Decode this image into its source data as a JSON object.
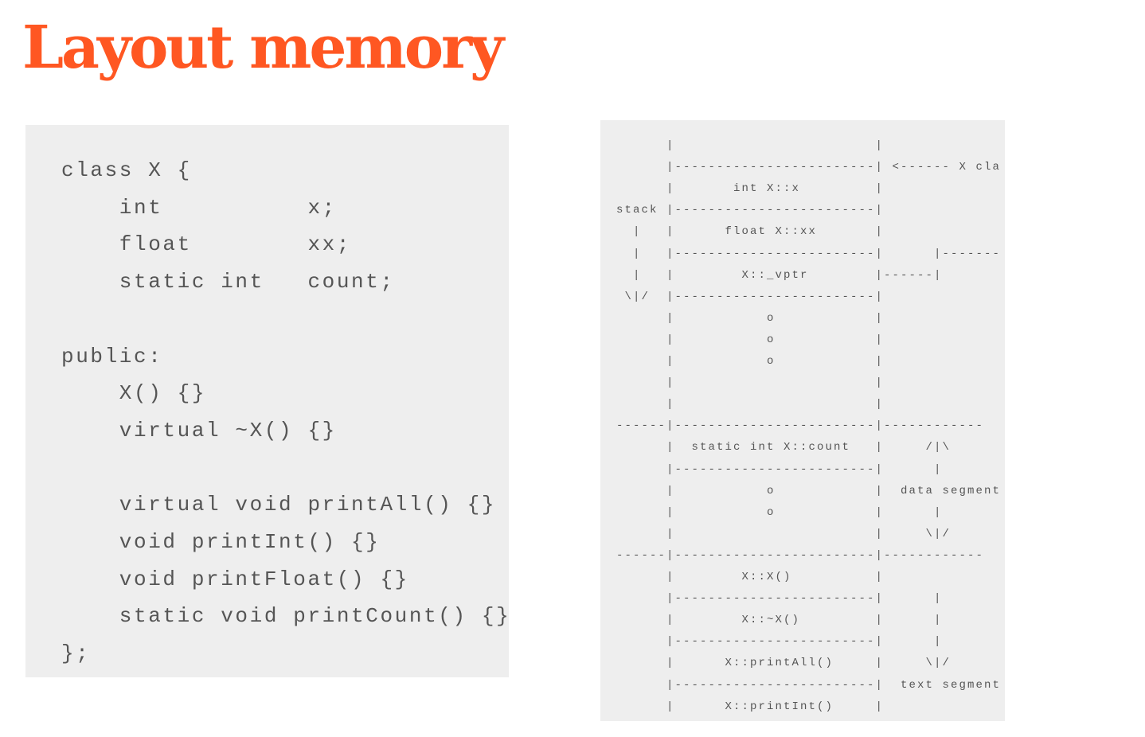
{
  "title": "Layout memory",
  "code_lines": [
    "class X {",
    "    int          x;",
    "    float        xx;",
    "    static int   count;",
    "",
    "public:",
    "    X() {}",
    "    virtual ~X() {}",
    "",
    "    virtual void printAll() {}",
    "    void printInt() {}",
    "    void printFloat() {}",
    "    static void printCount() {}",
    "};"
  ],
  "diagram_lines": [
    "      |                        |",
    "      |------------------------| <------ X cla",
    "      |       int X::x         |",
    "stack |------------------------|",
    "  |   |      float X::xx       |",
    "  |   |------------------------|      |-------",
    "  |   |        X::_vptr        |------|",
    " \\|/  |------------------------|",
    "      |           o            |",
    "      |           o            |",
    "      |           o            |",
    "      |                        |",
    "      |                        |",
    "------|------------------------|------------",
    "      |  static int X::count   |     /|\\",
    "      |------------------------|      |",
    "      |           o            |  data segment",
    "      |           o            |      |",
    "      |                        |     \\|/",
    "------|------------------------|------------",
    "      |        X::X()          |",
    "      |------------------------|      |",
    "      |        X::~X()         |      |",
    "      |------------------------|      |",
    "      |      X::printAll()     |     \\|/",
    "      |------------------------|  text segment",
    "      |      X::printInt()     |"
  ]
}
